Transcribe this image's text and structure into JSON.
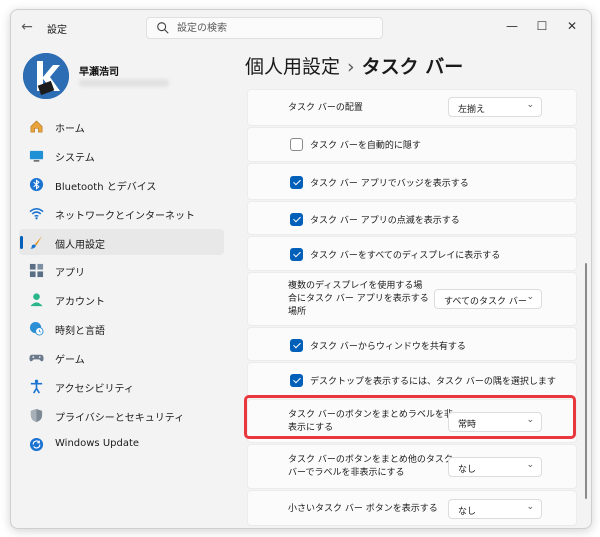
{
  "window": {
    "app_title": "設定"
  },
  "search": {
    "placeholder": "設定の検索"
  },
  "user": {
    "name": "早瀬浩司"
  },
  "sidebar": {
    "items": [
      {
        "label": "ホーム",
        "icon": "home-icon"
      },
      {
        "label": "システム",
        "icon": "system-icon"
      },
      {
        "label": "Bluetooth とデバイス",
        "icon": "bluetooth-icon"
      },
      {
        "label": "ネットワークとインターネット",
        "icon": "wifi-icon"
      },
      {
        "label": "個人用設定",
        "icon": "brush-icon",
        "active": true
      },
      {
        "label": "アプリ",
        "icon": "apps-icon"
      },
      {
        "label": "アカウント",
        "icon": "account-icon"
      },
      {
        "label": "時刻と言語",
        "icon": "globe-clock-icon"
      },
      {
        "label": "ゲーム",
        "icon": "gamepad-icon"
      },
      {
        "label": "アクセシビリティ",
        "icon": "accessibility-icon"
      },
      {
        "label": "プライバシーとセキュリティ",
        "icon": "shield-icon"
      },
      {
        "label": "Windows Update",
        "icon": "update-icon"
      }
    ]
  },
  "breadcrumb": {
    "parent": "個人用設定",
    "separator": "›",
    "current": "タスク バー"
  },
  "settings": {
    "alignment": {
      "label": "タスク バーの配置",
      "value": "左揃え"
    },
    "autohide": {
      "label": "タスク バーを自動的に隠す",
      "checked": false
    },
    "badges": {
      "label": "タスク バー アプリでバッジを表示する",
      "checked": true
    },
    "flashing": {
      "label": "タスク バー アプリの点滅を表示する",
      "checked": true
    },
    "all_displays": {
      "label": "タスク バーをすべてのディスプレイに表示する",
      "checked": true
    },
    "multi_display": {
      "label_1": "複数のディスプレイを使用する場",
      "label_2": "合にタスク バー アプリを表示する",
      "label_3": "場所",
      "value": "すべてのタスク バー"
    },
    "share_window": {
      "label": "タスク バーからウィンドウを共有する",
      "checked": true
    },
    "far_corner": {
      "label": "デスクトップを表示するには、タスク バーの隅を選択します",
      "checked": true
    },
    "combine_main": {
      "label_1": "タスク バーのボタンをまとめラベルを非",
      "label_2": "表示にする",
      "value": "常時"
    },
    "combine_other": {
      "label_1": "タスク バーのボタンをまとめ他のタスク",
      "label_2": "バーでラベルを非表示にする",
      "value": "なし"
    },
    "small_buttons": {
      "label": "小さいタスク バー ボタンを表示する",
      "value": "なし"
    }
  },
  "colors": {
    "accent": "#005fb8",
    "highlight": "#e8383d"
  }
}
